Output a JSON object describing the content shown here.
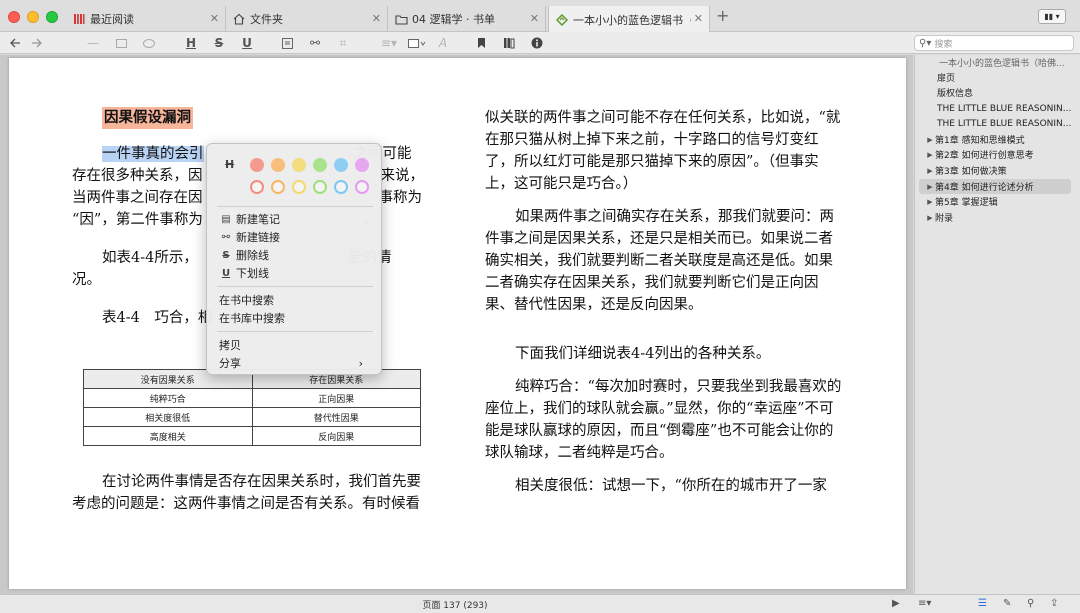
{
  "tabs": [
    {
      "label": "最近阅读",
      "icon": "books-icon"
    },
    {
      "label": "文件夹",
      "icon": "home-icon"
    },
    {
      "label": "04 逻辑学 · 书单",
      "icon": "folder-icon"
    },
    {
      "label": "一本小小的蓝色逻辑书（哈佛大",
      "icon": "epub-icon"
    }
  ],
  "toolbar": {
    "strikethrough_h": "H",
    "strikethrough_s": "S",
    "underline": "U",
    "text_a": "A",
    "search_placeholder": "搜索"
  },
  "document": {
    "heading": "因果假设漏洞",
    "left_col": {
      "para1_highlight": "一件事真的会引",
      "para1_end": "之间可能",
      "para1_l2_a": "存在很多种关系，因",
      "para1_l2_b": "来说，",
      "para1_l3_a": "当两件事之间存在因",
      "para1_l3_b": "事称为",
      "para1_l4_a": "“因”，第二件事称为",
      "para1_l4_b": "。",
      "para2_l1_a": "如表4-4所示，",
      "para2_l1_b": "能的情",
      "para2_l2": "况。",
      "table_caption": "表4-4　巧合，相",
      "para3": "在讨论两件事情是否存在因果关系时，我们首先要考虑的问题是：这两件事情之间是否有关系。有时候看"
    },
    "table": {
      "headers": [
        "没有因果关系",
        "存在因果关系"
      ],
      "rows": [
        [
          "纯粹巧合",
          "正向因果"
        ],
        [
          "相关度很低",
          "替代性因果"
        ],
        [
          "高度相关",
          "反向因果"
        ]
      ]
    },
    "right_col": {
      "p1": "似关联的两件事之间可能不存在任何关系，比如说，“就在那只猫从树上掉下来之前，十字路口的信号灯变红了，所以红灯可能是那只猫掉下来的原因”。（但事实上，这可能只是巧合。）",
      "p2": "如果两件事之间确实存在关系，那我们就要问：两件事之间是因果关系，还是只是相关而已。如果说二者确实相关，我们就要判断二者关联度是高还是低。如果二者确实存在因果关系，我们就要判断它们是正向因果、替代性因果，还是反向因果。",
      "p3": "下面我们详细说表4-4列出的各种关系。",
      "p4": "纯粹巧合：“每次加时赛时，只要我坐到我最喜欢的座位上，我们的球队就会赢。”显然，你的“幸运座”不可能是球队赢球的原因，而且“倒霉座”也不可能会让你的球队输球，二者纯粹是巧合。",
      "p5": "相关度很低：试想一下，“你所在的城市开了一家"
    }
  },
  "context_menu": {
    "highlight_style": "H",
    "colors_row1": [
      "#f58b7e",
      "#f9b56a",
      "#f4d96a",
      "#9ee07a",
      "#7cc8f2",
      "#e49af0"
    ],
    "colors_row2": [
      "#f58b7e",
      "#f9b56a",
      "#f4d96a",
      "#9ee07a",
      "#7cc8f2",
      "#e49af0"
    ],
    "items": [
      {
        "label": "新建笔记",
        "icon": "note-icon"
      },
      {
        "label": "新建链接",
        "icon": "link-icon"
      },
      {
        "label": "删除线",
        "icon": "strikethrough-icon"
      },
      {
        "label": "下划线",
        "icon": "underline-icon"
      }
    ],
    "search_book": "在书中搜索",
    "search_library": "在书库中搜索",
    "copy": "拷贝",
    "share": "分享"
  },
  "sidebar": {
    "items": [
      {
        "label": "一本小小的蓝色逻辑书（哈佛...",
        "level": 0,
        "expandable": false,
        "selected": false
      },
      {
        "label": "扉页",
        "level": 1,
        "expandable": false,
        "selected": false
      },
      {
        "label": "版权信息",
        "level": 1,
        "expandable": false,
        "selected": false
      },
      {
        "label": "THE LITTLE BLUE REASONIN...",
        "level": 1,
        "expandable": false,
        "selected": false
      },
      {
        "label": "THE LITTLE BLUE REASONIN...",
        "level": 1,
        "expandable": false,
        "selected": false
      },
      {
        "label": "第1章 感知和思维模式",
        "level": 1,
        "expandable": true,
        "selected": false
      },
      {
        "label": "第2章 如何进行创意思考",
        "level": 1,
        "expandable": true,
        "selected": false
      },
      {
        "label": "第3章 如何做决策",
        "level": 1,
        "expandable": true,
        "selected": false
      },
      {
        "label": "第4章 如何进行论述分析",
        "level": 1,
        "expandable": true,
        "selected": true
      },
      {
        "label": "第5章 掌握逻辑",
        "level": 1,
        "expandable": true,
        "selected": false
      },
      {
        "label": "附录",
        "level": 1,
        "expandable": true,
        "selected": false
      }
    ]
  },
  "status": {
    "page_label": "页面 137 (293)"
  }
}
